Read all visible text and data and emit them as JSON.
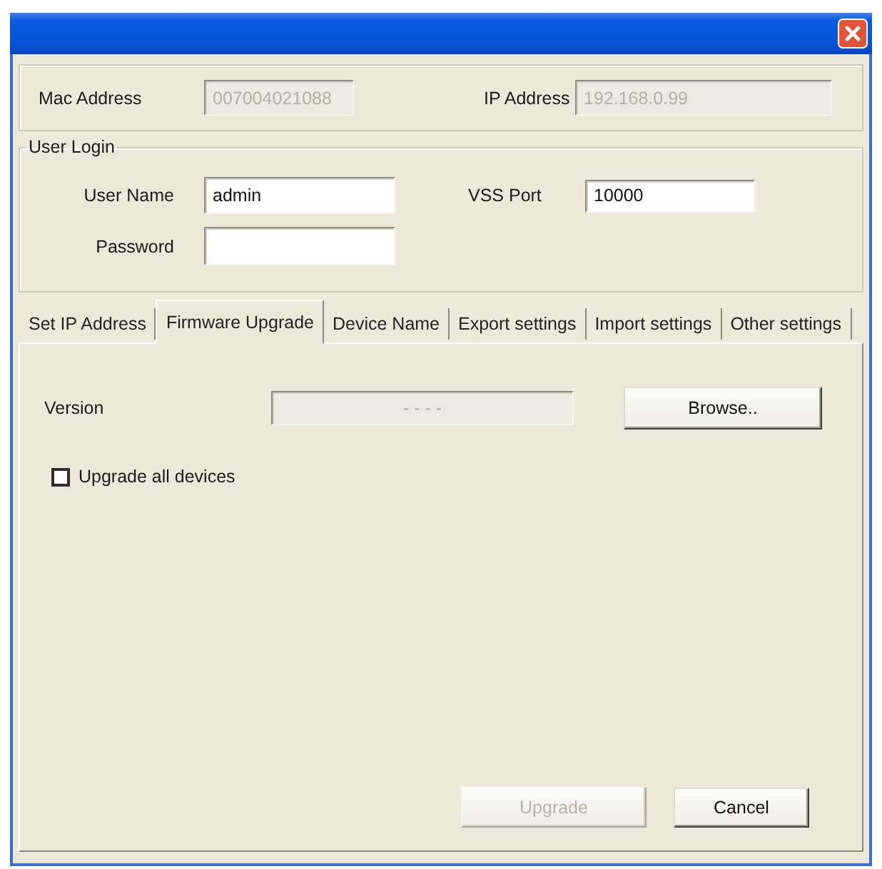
{
  "device_info": {
    "mac_address": {
      "label": "Mac Address",
      "value": "007004021088",
      "disabled": true
    },
    "ip_address": {
      "label": "IP Address",
      "value": "192.168.0.99",
      "disabled": true
    }
  },
  "user_login": {
    "title": "User Login",
    "user_name": {
      "label": "User Name",
      "value": "admin"
    },
    "password": {
      "label": "Password"
    },
    "vss_port": {
      "label": "VSS Port",
      "value": "10000"
    }
  },
  "tabs": [
    {
      "label": "Set IP Address",
      "selected": false
    },
    {
      "label": "Firmware Upgrade",
      "selected": true
    },
    {
      "label": "Device Name",
      "selected": false
    },
    {
      "label": "Export settings",
      "selected": false
    },
    {
      "label": "Import settings",
      "selected": false
    },
    {
      "label": "Other settings",
      "selected": false
    }
  ],
  "firmware_upgrade": {
    "version": {
      "label": "Version",
      "value": "- - - -",
      "disabled": true
    },
    "browse_button": "Browse..",
    "upgrade_all": {
      "label": "Upgrade all devices",
      "checked": false
    }
  },
  "upgrade_button": {
    "label": "Upgrade",
    "disabled": true
  },
  "cancel_button": {
    "label": "Cancel",
    "disabled": false
  }
}
